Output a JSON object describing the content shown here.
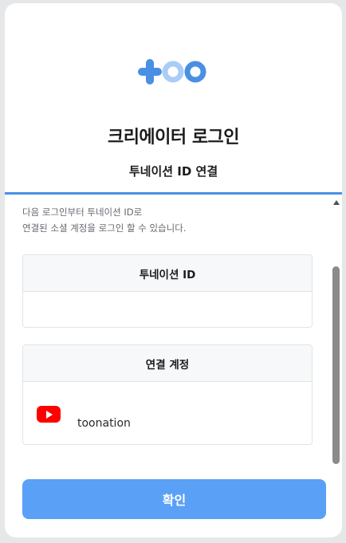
{
  "logo": {
    "name": "toonation-logo",
    "color_plus": "#4a90e2",
    "color_ring_light": "#a9cdf6",
    "color_ring": "#4a90e2"
  },
  "title": "크리에이터 로그인",
  "subtitle": "투네이션 ID 연결",
  "description": {
    "line1": "다음 로그인부터 투네이션 ID로",
    "line2": "연결된 소셜 계정을 로그인 할 수 있습니다."
  },
  "id_box": {
    "header": "투네이션 ID",
    "value": ""
  },
  "account_box": {
    "header": "연결 계정",
    "account": {
      "platform_icon": "youtube-icon",
      "name": "toonation"
    }
  },
  "confirm_button": {
    "label": "확인",
    "color": "#5aa0f7"
  },
  "accent_color": "#4a90e2"
}
